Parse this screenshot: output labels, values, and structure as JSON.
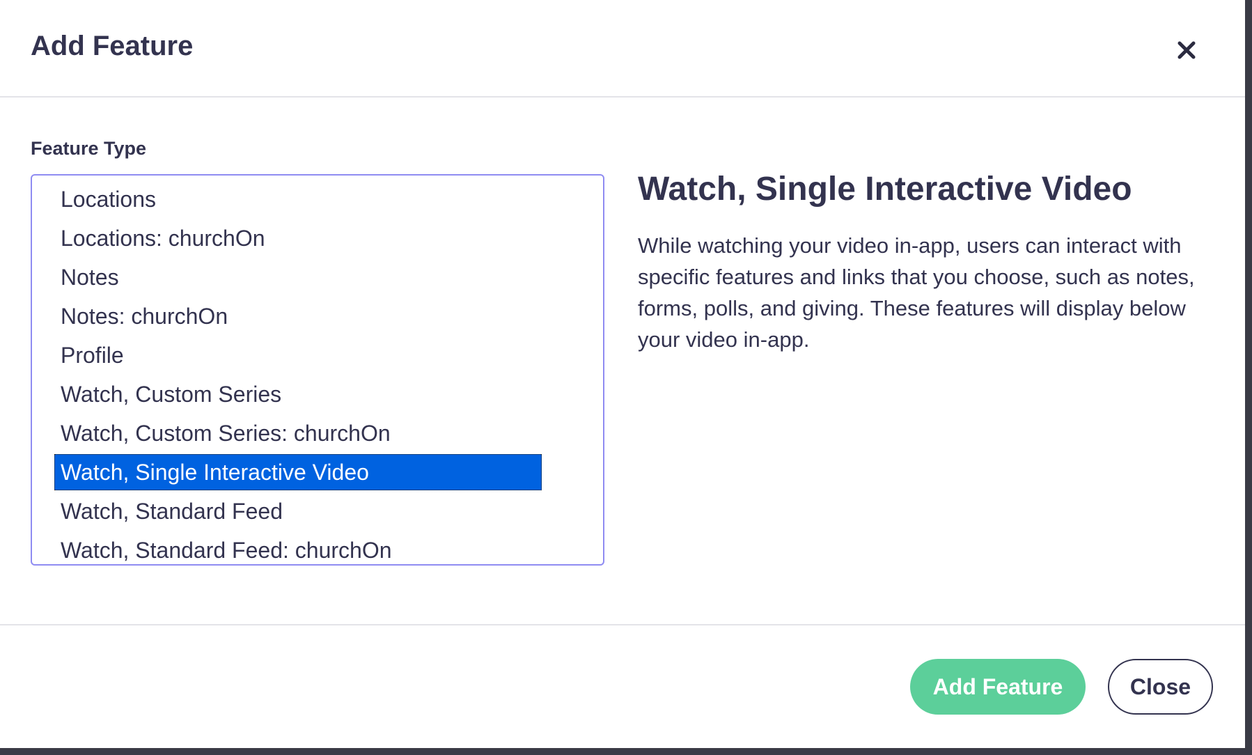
{
  "dialog": {
    "title": "Add Feature",
    "close_icon": "close-icon"
  },
  "form": {
    "feature_type_label": "Feature Type",
    "options": [
      "Locations",
      "Locations: churchOn",
      "Notes",
      "Notes: churchOn",
      "Profile",
      "Watch, Custom Series",
      "Watch, Custom Series: churchOn",
      "Watch, Single Interactive Video",
      "Watch, Standard Feed",
      "Watch, Standard Feed: churchOn"
    ],
    "selected_index": 7
  },
  "description": {
    "title": "Watch, Single Interactive Video",
    "text": "While watching your video in-app, users can interact with specific features and links that you choose, such as notes, forms, polls, and giving. These features will display below your video in-app."
  },
  "footer": {
    "add_label": "Add Feature",
    "close_label": "Close"
  },
  "colors": {
    "primary_text": "#33334f",
    "selected_bg": "#0062e0",
    "add_button": "#5ccf9a",
    "listbox_border": "#8f8cf2"
  }
}
